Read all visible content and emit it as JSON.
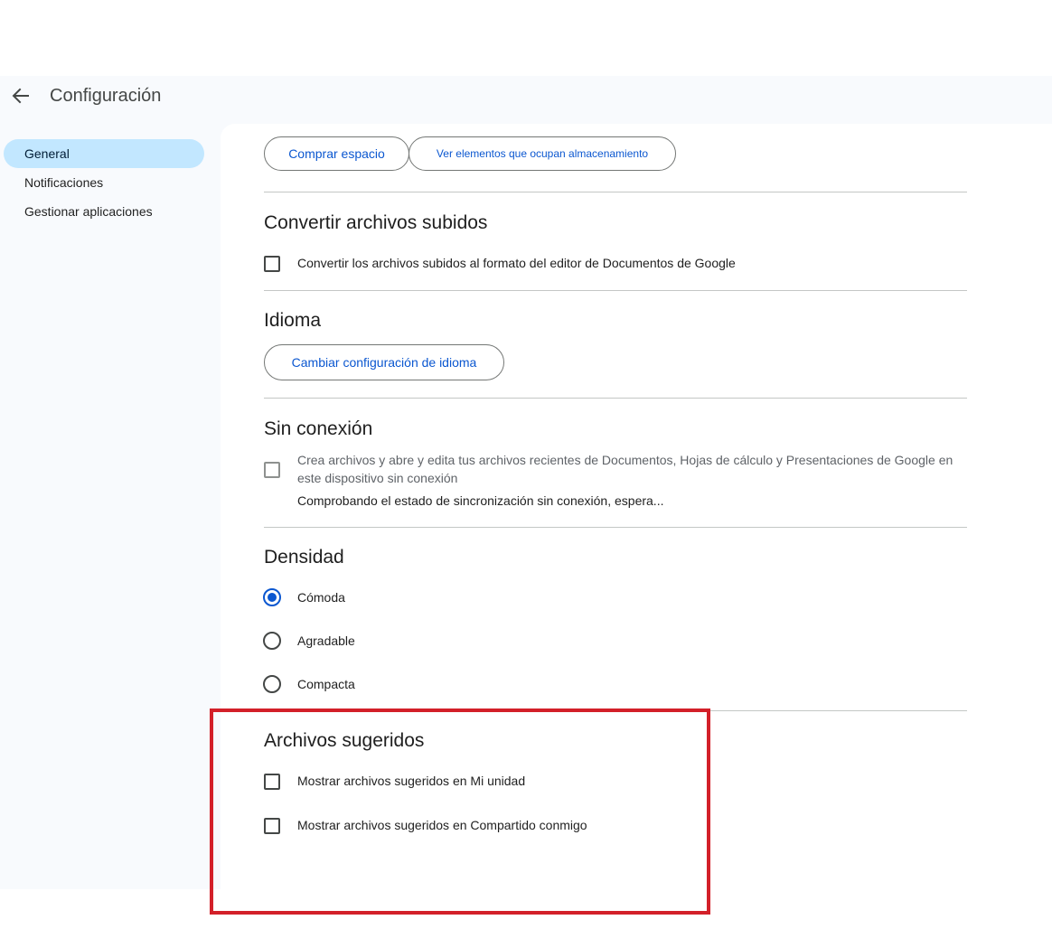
{
  "header": {
    "title": "Configuración",
    "back_icon": "arrow-back-icon"
  },
  "sidebar": {
    "items": [
      {
        "label": "General",
        "active": true
      },
      {
        "label": "Notificaciones",
        "active": false
      },
      {
        "label": "Gestionar aplicaciones",
        "active": false
      }
    ]
  },
  "storage": {
    "buy_label": "Comprar espacio",
    "view_items_label": "Ver elementos que ocupan almacenamiento"
  },
  "convert": {
    "title": "Convertir archivos subidos",
    "checkbox_label": "Convertir los archivos subidos al formato del editor de Documentos de Google",
    "checked": false
  },
  "language": {
    "title": "Idioma",
    "button_label": "Cambiar configuración de idioma"
  },
  "offline": {
    "title": "Sin conexión",
    "checkbox_line1": "Crea archivos y abre y edita tus archivos recientes de Documentos, Hojas de cálculo y Presentaciones de Google en",
    "checkbox_line2": "este dispositivo sin conexión",
    "status": "Comprobando el estado de sincronización sin conexión, espera...",
    "checked": false,
    "disabled": true
  },
  "density": {
    "title": "Densidad",
    "options": [
      {
        "label": "Cómoda",
        "selected": true
      },
      {
        "label": "Agradable",
        "selected": false
      },
      {
        "label": "Compacta",
        "selected": false
      }
    ]
  },
  "suggested": {
    "title": "Archivos sugeridos",
    "my_drive_label": "Mostrar archivos sugeridos en Mi unidad",
    "shared_label": "Mostrar archivos sugeridos en Compartido conmigo",
    "my_drive_checked": false,
    "shared_checked": false
  },
  "colors": {
    "accent": "#0b57d0",
    "nav_active_bg": "#c2e7ff",
    "highlight": "#d32029",
    "app_bg": "#f8fafd"
  }
}
